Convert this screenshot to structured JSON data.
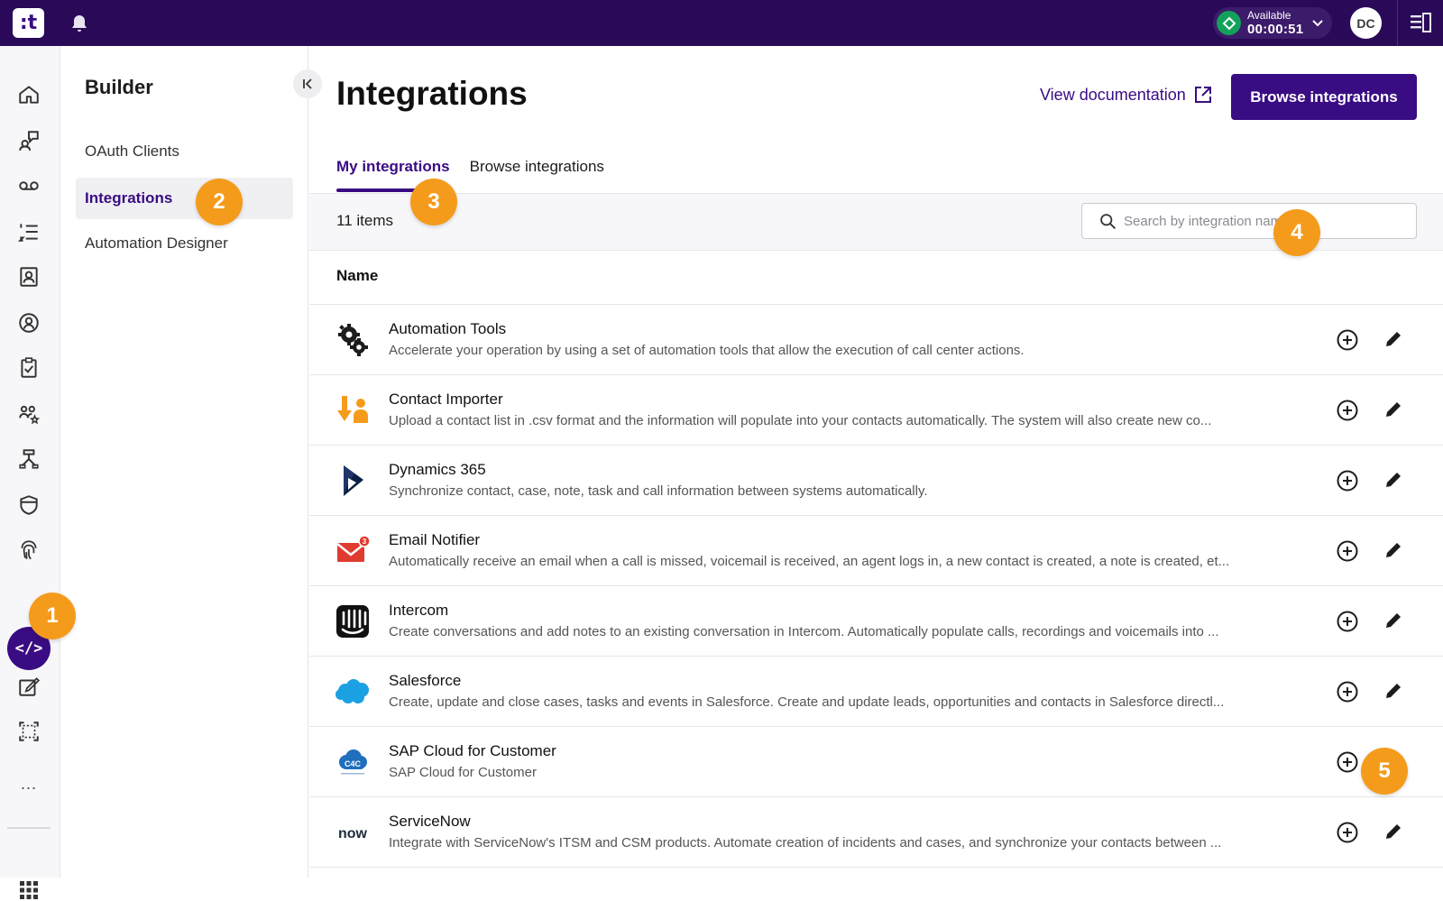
{
  "topbar": {
    "logo_text": ":t",
    "status_label": "Available",
    "status_timer": "00:00:51",
    "status_color": "#12a15a",
    "avatar_initials": "DC",
    "brand_color": "#2a0a58"
  },
  "rail": {
    "icons": [
      "home-icon",
      "chat-icon",
      "voicemail-icon",
      "list-icon",
      "contacts-icon",
      "agent-icon",
      "clipboard-icon",
      "team-icon",
      "routing-icon",
      "shield-icon",
      "fingerprint-icon",
      "code-icon",
      "edit-icon",
      "screen-icon"
    ],
    "active_label": "</>",
    "more_label": "..."
  },
  "sidebar": {
    "title": "Builder",
    "items": [
      {
        "label": "OAuth Clients"
      },
      {
        "label": "Integrations"
      },
      {
        "label": "Automation Designer"
      }
    ]
  },
  "main": {
    "title": "Integrations",
    "doc_link": "View documentation",
    "browse_button": "Browse integrations",
    "tabs": [
      {
        "label": "My integrations"
      },
      {
        "label": "Browse integrations"
      }
    ],
    "count": "11 items",
    "search_placeholder": "Search by integration name",
    "column_name": "Name",
    "accent_color": "#3a0c83",
    "rows": [
      {
        "name": "Automation Tools",
        "desc": "Accelerate your operation by using a set of automation tools that allow the execution of call center actions.",
        "icon": "gears-icon"
      },
      {
        "name": "Contact Importer",
        "desc": "Upload a contact list in .csv format and the information will populate into your contacts automatically. The system will also create new co...",
        "icon": "contact-importer-icon"
      },
      {
        "name": "Dynamics 365",
        "desc": "Synchronize contact, case, note, task and call information between systems automatically.",
        "icon": "dynamics-icon"
      },
      {
        "name": "Email Notifier",
        "desc": "Automatically receive an email when a call is missed, voicemail is received, an agent logs in, a new contact is created, a note is created, et...",
        "icon": "email-notifier-icon"
      },
      {
        "name": "Intercom",
        "desc": "Create conversations and add notes to an existing conversation in Intercom. Automatically populate calls, recordings and voicemails into ...",
        "icon": "intercom-icon"
      },
      {
        "name": "Salesforce",
        "desc": "Create, update and close cases, tasks and events in Salesforce. Create and update leads, opportunities and contacts in Salesforce directl...",
        "icon": "salesforce-icon"
      },
      {
        "name": "SAP Cloud for Customer",
        "desc": "SAP Cloud for Customer",
        "icon": "sap-icon"
      },
      {
        "name": "ServiceNow",
        "desc": "Integrate with ServiceNow's ITSM and CSM products. Automate creation of incidents and cases, and synchronize your contacts between ...",
        "icon": "servicenow-icon"
      }
    ]
  },
  "badges": [
    "1",
    "2",
    "3",
    "4",
    "5"
  ],
  "logos": {
    "sap_text": "C4C",
    "servicenow_text": "now",
    "email_count": "3"
  }
}
